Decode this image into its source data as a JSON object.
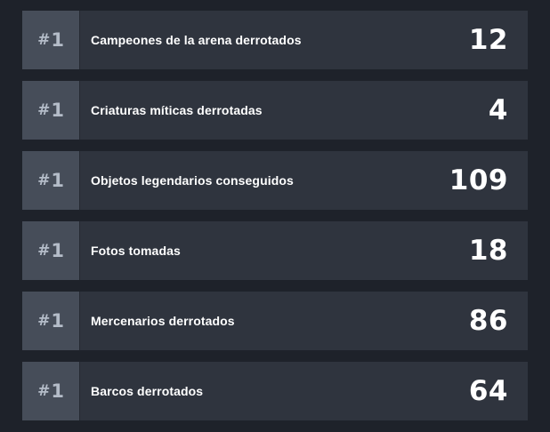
{
  "colors": {
    "background": "#1e222a",
    "row": "#2f343e",
    "rank_cell": "#464d59",
    "rank_text": "#b4bcc8",
    "text": "#ffffff"
  },
  "stats": [
    {
      "rank_hash": "#",
      "rank_num": "1",
      "label": "Campeones de la arena derrotados",
      "value": "12"
    },
    {
      "rank_hash": "#",
      "rank_num": "1",
      "label": "Criaturas míticas derrotadas",
      "value": "4"
    },
    {
      "rank_hash": "#",
      "rank_num": "1",
      "label": "Objetos legendarios conseguidos",
      "value": "109"
    },
    {
      "rank_hash": "#",
      "rank_num": "1",
      "label": "Fotos tomadas",
      "value": "18"
    },
    {
      "rank_hash": "#",
      "rank_num": "1",
      "label": "Mercenarios derrotados",
      "value": "86"
    },
    {
      "rank_hash": "#",
      "rank_num": "1",
      "label": "Barcos derrotados",
      "value": "64"
    }
  ]
}
